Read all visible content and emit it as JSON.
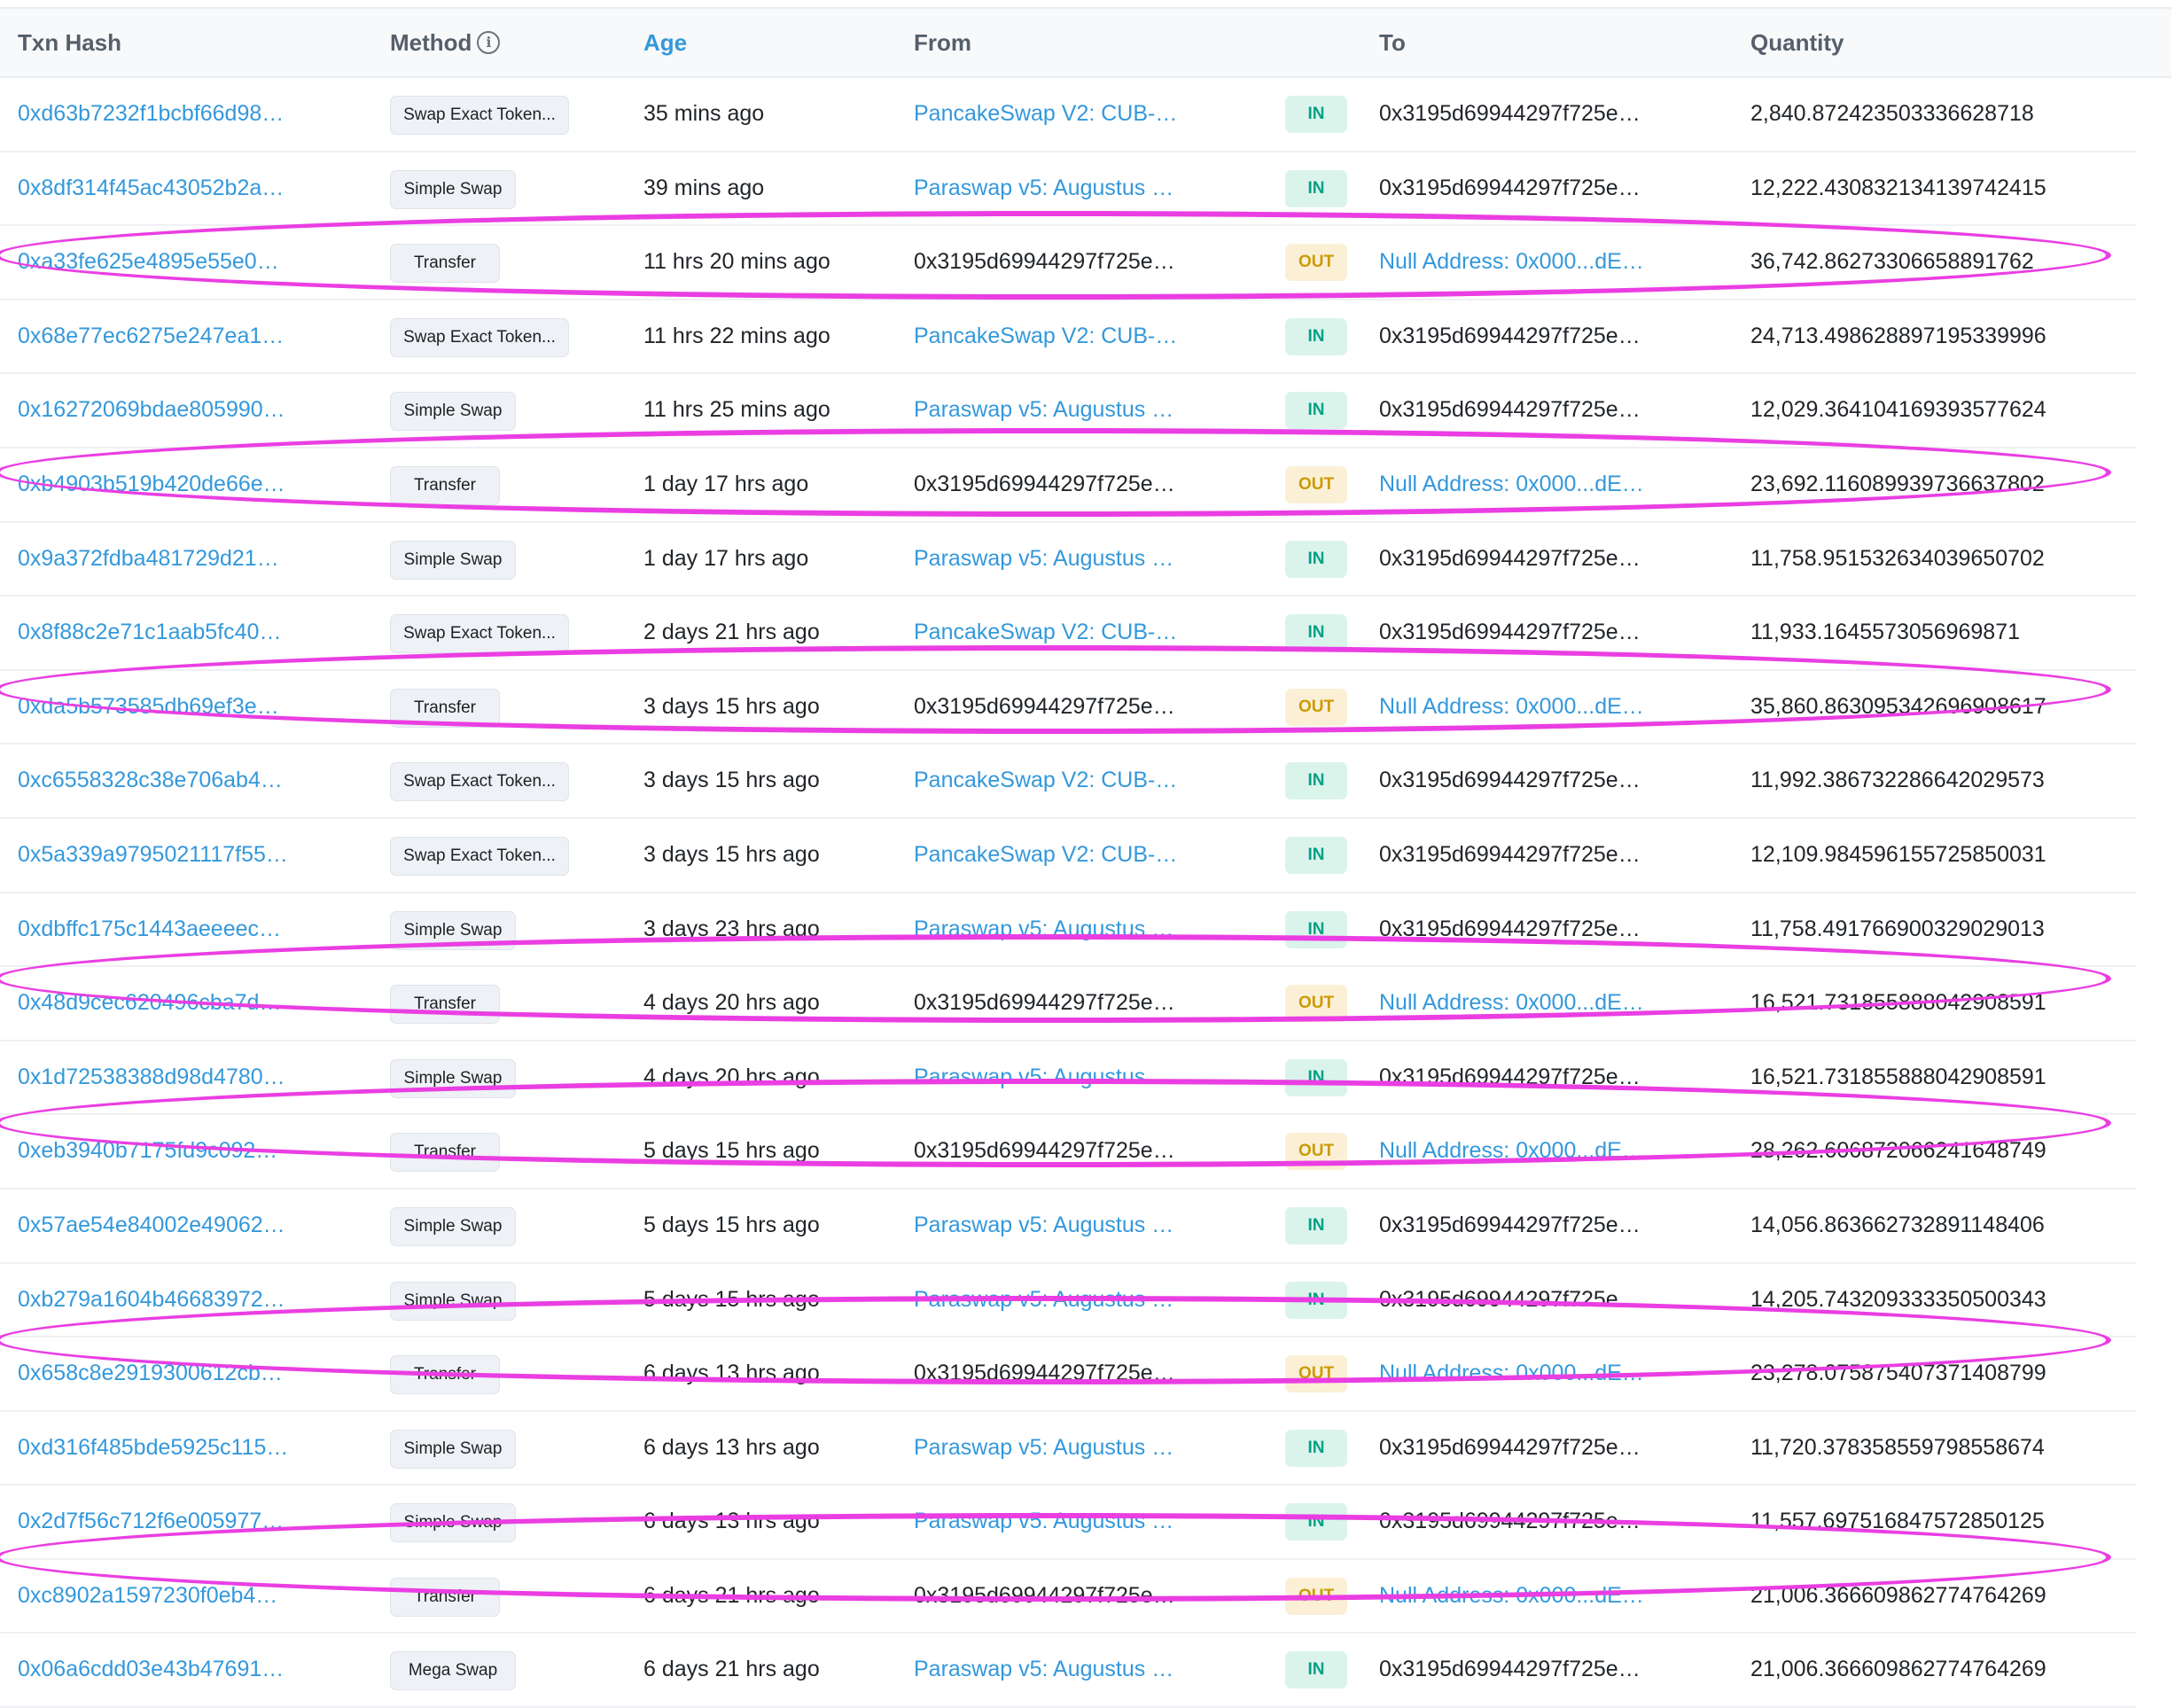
{
  "header": {
    "txn_hash": "Txn Hash",
    "method": "Method",
    "age": "Age",
    "from": "From",
    "to": "To",
    "quantity": "Quantity",
    "method_info_icon": "info-icon"
  },
  "rows": [
    {
      "hash": "0xd63b7232f1bcbf66d98…",
      "method": "Swap Exact Token...",
      "age": "35 mins ago",
      "from": "PancakeSwap V2: CUB-…",
      "dir": "IN",
      "to": "0x3195d69944297f725e…",
      "qty": "2,840.872423503336628718",
      "highlighted": false
    },
    {
      "hash": "0x8df314f45ac43052b2a…",
      "method": "Simple Swap",
      "age": "39 mins ago",
      "from": "Paraswap v5: Augustus …",
      "dir": "IN",
      "to": "0x3195d69944297f725e…",
      "qty": "12,222.430832134139742415",
      "highlighted": false
    },
    {
      "hash": "0xa33fe625e4895e55e0…",
      "method": "Transfer",
      "age": "11 hrs 20 mins ago",
      "from": "0x3195d69944297f725e…",
      "dir": "OUT",
      "to": "Null Address: 0x000...dE…",
      "qty": "36,742.86273306658891762",
      "highlighted": true
    },
    {
      "hash": "0x68e77ec6275e247ea1…",
      "method": "Swap Exact Token...",
      "age": "11 hrs 22 mins ago",
      "from": "PancakeSwap V2: CUB-…",
      "dir": "IN",
      "to": "0x3195d69944297f725e…",
      "qty": "24,713.498628897195339996",
      "highlighted": false
    },
    {
      "hash": "0x16272069bdae805990…",
      "method": "Simple Swap",
      "age": "11 hrs 25 mins ago",
      "from": "Paraswap v5: Augustus …",
      "dir": "IN",
      "to": "0x3195d69944297f725e…",
      "qty": "12,029.364104169393577624",
      "highlighted": false
    },
    {
      "hash": "0xb4903b519b420de66e…",
      "method": "Transfer",
      "age": "1 day 17 hrs ago",
      "from": "0x3195d69944297f725e…",
      "dir": "OUT",
      "to": "Null Address: 0x000...dE…",
      "qty": "23,692.116089939736637802",
      "highlighted": true
    },
    {
      "hash": "0x9a372fdba481729d21…",
      "method": "Simple Swap",
      "age": "1 day 17 hrs ago",
      "from": "Paraswap v5: Augustus …",
      "dir": "IN",
      "to": "0x3195d69944297f725e…",
      "qty": "11,758.951532634039650702",
      "highlighted": false
    },
    {
      "hash": "0x8f88c2e71c1aab5fc40…",
      "method": "Swap Exact Token...",
      "age": "2 days 21 hrs ago",
      "from": "PancakeSwap V2: CUB-…",
      "dir": "IN",
      "to": "0x3195d69944297f725e…",
      "qty": "11,933.1645573056969871",
      "highlighted": false
    },
    {
      "hash": "0xda5b573585db69ef3e…",
      "method": "Transfer",
      "age": "3 days 15 hrs ago",
      "from": "0x3195d69944297f725e…",
      "dir": "OUT",
      "to": "Null Address: 0x000...dE…",
      "qty": "35,860.863095342696908617",
      "highlighted": true
    },
    {
      "hash": "0xc6558328c38e706ab4…",
      "method": "Swap Exact Token...",
      "age": "3 days 15 hrs ago",
      "from": "PancakeSwap V2: CUB-…",
      "dir": "IN",
      "to": "0x3195d69944297f725e…",
      "qty": "11,992.386732286642029573",
      "highlighted": false
    },
    {
      "hash": "0x5a339a9795021117f55…",
      "method": "Swap Exact Token...",
      "age": "3 days 15 hrs ago",
      "from": "PancakeSwap V2: CUB-…",
      "dir": "IN",
      "to": "0x3195d69944297f725e…",
      "qty": "12,109.984596155725850031",
      "highlighted": false
    },
    {
      "hash": "0xdbffc175c1443aeeeec…",
      "method": "Simple Swap",
      "age": "3 days 23 hrs ago",
      "from": "Paraswap v5: Augustus …",
      "dir": "IN",
      "to": "0x3195d69944297f725e…",
      "qty": "11,758.491766900329029013",
      "highlighted": false
    },
    {
      "hash": "0x48d9cec620496cba7d…",
      "method": "Transfer",
      "age": "4 days 20 hrs ago",
      "from": "0x3195d69944297f725e…",
      "dir": "OUT",
      "to": "Null Address: 0x000...dE…",
      "qty": "16,521.731855888042908591",
      "highlighted": true
    },
    {
      "hash": "0x1d72538388d98d4780…",
      "method": "Simple Swap",
      "age": "4 days 20 hrs ago",
      "from": "Paraswap v5: Augustus …",
      "dir": "IN",
      "to": "0x3195d69944297f725e…",
      "qty": "16,521.731855888042908591",
      "highlighted": false
    },
    {
      "hash": "0xeb3940b7175fd9c092…",
      "method": "Transfer",
      "age": "5 days 15 hrs ago",
      "from": "0x3195d69944297f725e…",
      "dir": "OUT",
      "to": "Null Address: 0x000...dE…",
      "qty": "28,262.606872066241648749",
      "highlighted": true
    },
    {
      "hash": "0x57ae54e84002e49062…",
      "method": "Simple Swap",
      "age": "5 days 15 hrs ago",
      "from": "Paraswap v5: Augustus …",
      "dir": "IN",
      "to": "0x3195d69944297f725e…",
      "qty": "14,056.863662732891148406",
      "highlighted": false
    },
    {
      "hash": "0xb279a1604b46683972…",
      "method": "Simple Swap",
      "age": "5 days 15 hrs ago",
      "from": "Paraswap v5: Augustus …",
      "dir": "IN",
      "to": "0x3195d69944297f725e…",
      "qty": "14,205.743209333350500343",
      "highlighted": false
    },
    {
      "hash": "0x658c8e2919300612cb…",
      "method": "Transfer",
      "age": "6 days 13 hrs ago",
      "from": "0x3195d69944297f725e…",
      "dir": "OUT",
      "to": "Null Address: 0x000...dE…",
      "qty": "23,278.075875407371408799",
      "highlighted": true
    },
    {
      "hash": "0xd316f485bde5925c115…",
      "method": "Simple Swap",
      "age": "6 days 13 hrs ago",
      "from": "Paraswap v5: Augustus …",
      "dir": "IN",
      "to": "0x3195d69944297f725e…",
      "qty": "11,720.378358559798558674",
      "highlighted": false
    },
    {
      "hash": "0x2d7f56c712f6e005977…",
      "method": "Simple Swap",
      "age": "6 days 13 hrs ago",
      "from": "Paraswap v5: Augustus …",
      "dir": "IN",
      "to": "0x3195d69944297f725e…",
      "qty": "11,557.697516847572850125",
      "highlighted": false
    },
    {
      "hash": "0xc8902a1597230f0eb4…",
      "method": "Transfer",
      "age": "6 days 21 hrs ago",
      "from": "0x3195d69944297f725e…",
      "dir": "OUT",
      "to": "Null Address: 0x000...dE…",
      "qty": "21,006.366609862774764269",
      "highlighted": true
    },
    {
      "hash": "0x06a6cdd03e43b47691…",
      "method": "Mega Swap",
      "age": "6 days 21 hrs ago",
      "from": "Paraswap v5: Augustus …",
      "dir": "IN",
      "to": "0x3195d69944297f725e…",
      "qty": "21,006.366609862774764269",
      "highlighted": false
    }
  ],
  "colors": {
    "link": "#3498db",
    "in_badge_bg": "#daf4ec",
    "in_badge_text": "#00a186",
    "out_badge_bg": "#fbf0d6",
    "out_badge_text": "#cc9a06",
    "highlight_ring": "#ea3ee3"
  }
}
